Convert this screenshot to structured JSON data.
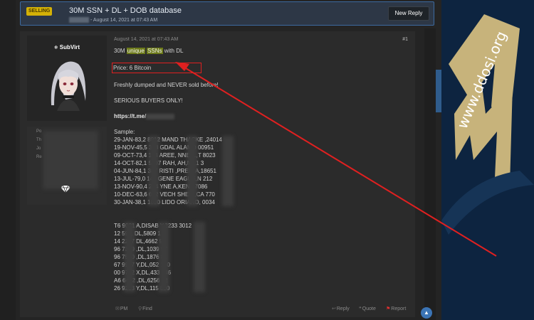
{
  "header": {
    "badge": "SELLING",
    "title": "30M SSN + DL + DOB database",
    "meta_date": "- August 14, 2021 at 07:43 AM",
    "new_reply_label": "New Reply"
  },
  "post": {
    "date": "August 14, 2021 at 07:43 AM",
    "number": "#1",
    "username": "SubVirt",
    "info_labels": [
      "Po",
      "Th",
      "Jo",
      "Re"
    ],
    "line1_pre": "30M ",
    "line1_hl1": "unique",
    "line1_hl2": "SSNs",
    "line1_post": " with DL",
    "price": "Price: 6 Bitcoin",
    "fresh": "Freshly dumped and NEVER sold before!",
    "serious": "SERIOUS BUYERS ONLY!",
    "telegram": "https://t.me/",
    "sample_label": "Sample:",
    "sample_rows": [
      "29-JAN-83,2        8012      MAND       THACKE       ,24014",
      "19-NOV-45,5        358       GDAL       ALAMO       00951",
      "09-OCT-73,4        194       AREE,      NNELL,T      8023",
      "14-OCT-82,1        5097      RAH,       AH,NY,1      3",
      "04-JUN-84,1        38T       RISTI      ,PREBI       A,18651",
      "13-JUL-79,0        140       GENE       EAGUE,N      212",
      "13-NOV-90,4        294       YNE        A,KENT       7086",
      "10-DEC-63,6        602       VECH       SHEIN,CA     770",
      "30-JAN-38,1        1830      LIDO       ORIANO,      0034"
    ],
    "dl_rows": [
      "T6          9021      A,DISAB       Y,2233       3012",
      "12          594,      DL,5809       1",
      "14          2287      DL,4662       94",
      "96          7369      ,DL,1039      97",
      "96          7540      ,DL,1876      81",
      "67          9987      Y,DL,052      140",
      "00          9742      X,DL,433      946",
      "A6          6462      ,DL,6256      02",
      "26          9213      Y,DL,115      830"
    ],
    "footer": {
      "pm": "PM",
      "find": "Find",
      "reply": "Reply",
      "quote": "Quote",
      "report": "Report"
    }
  },
  "watermark": "www.ddosi.org",
  "colors": {
    "accent": "#3b74b5",
    "highlight": "#6d7a19",
    "annotation": "#e02020",
    "badge": "#d4b106"
  }
}
